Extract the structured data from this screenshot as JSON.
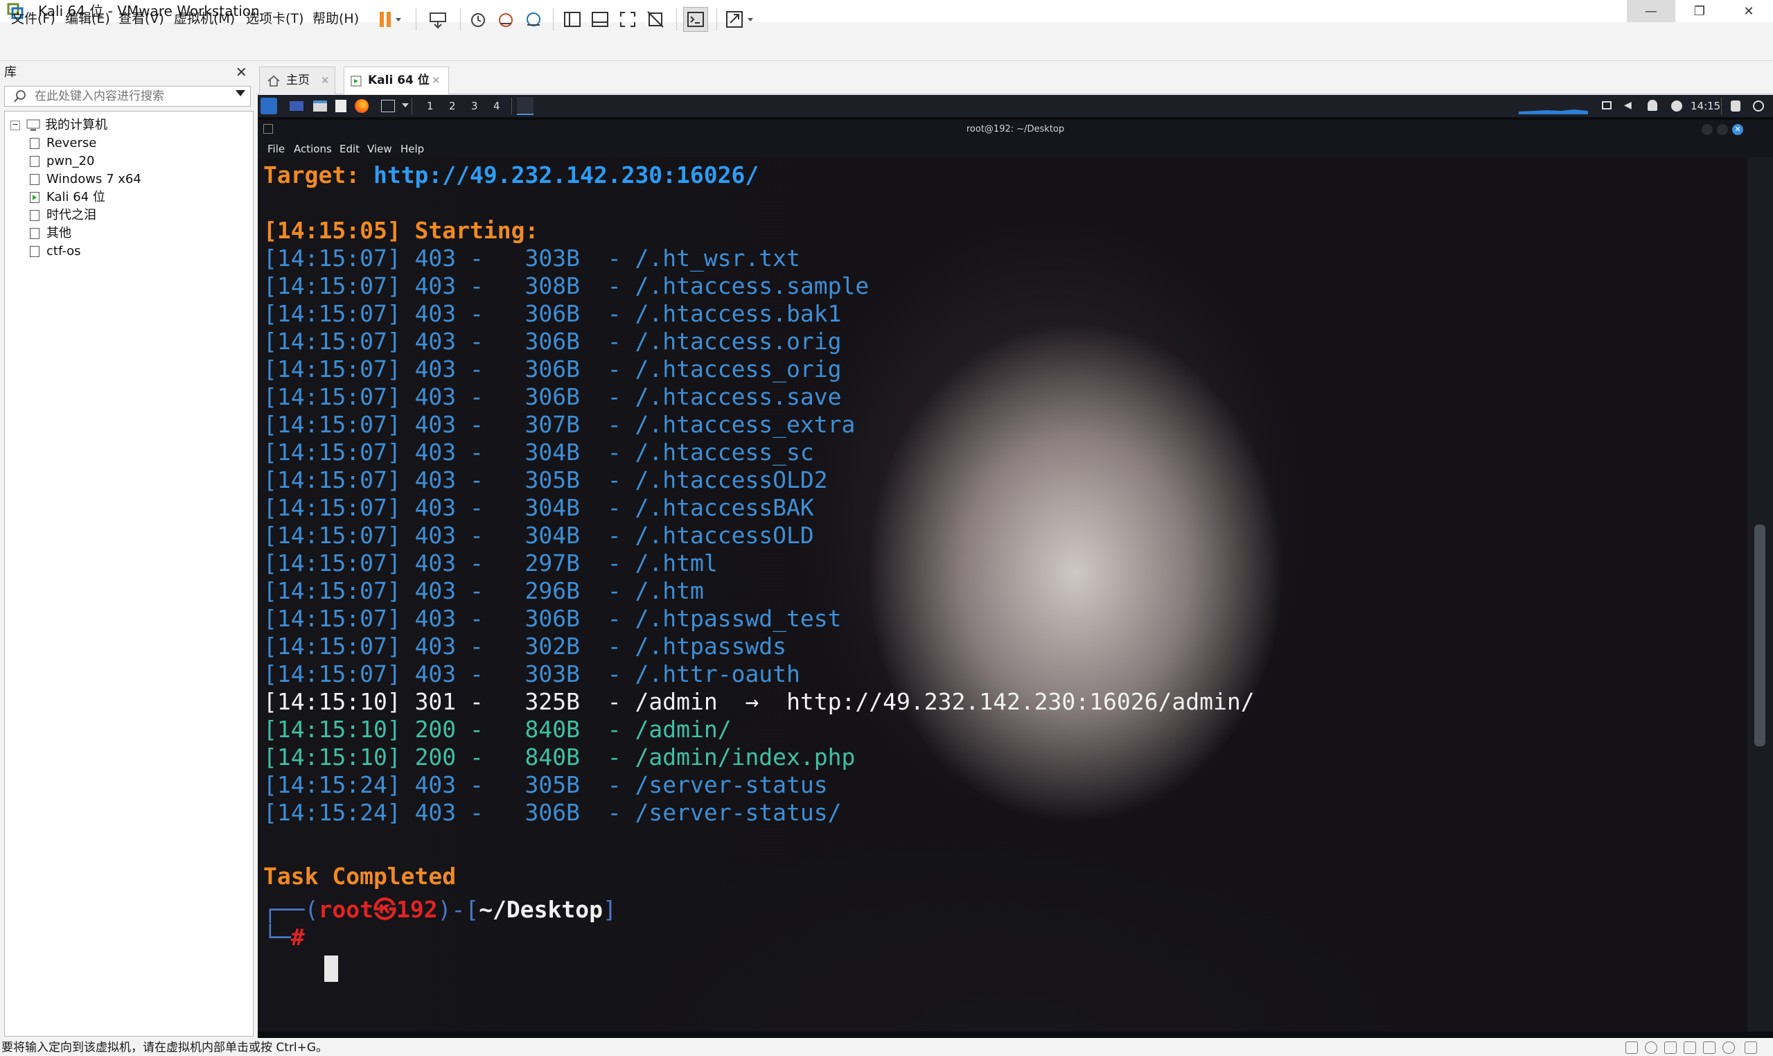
{
  "window": {
    "title": "Kali 64 位 - VMware Workstation",
    "controls": {
      "minimize": "—",
      "restore": "❐",
      "close": "✕"
    }
  },
  "menu": [
    "文件(F)",
    "编辑(E)",
    "查看(V)",
    "虚拟机(M)",
    "选项卡(T)",
    "帮助(H)"
  ],
  "library": {
    "title": "库",
    "close": "✕",
    "search_placeholder": "在此处键入内容进行搜索",
    "root": "我的计算机",
    "vms": [
      "Reverse",
      "pwn_20",
      "Windows 7 x64",
      "Kali 64 位",
      "时代之泪",
      "其他",
      "ctf-os"
    ],
    "running_vm_index": 3
  },
  "tabs": [
    {
      "label": "主页",
      "close": "✕"
    },
    {
      "label": "Kali 64 位",
      "close": "✕"
    }
  ],
  "kali_panel": {
    "workspaces": [
      "1",
      "2",
      "3",
      "4"
    ],
    "time": "14:15"
  },
  "terminal": {
    "title": "root@192: ~/Desktop",
    "menu": [
      "File",
      "Actions",
      "Edit",
      "View",
      "Help"
    ],
    "target_label": "Target:",
    "target_url": "http://49.232.142.230:16026/",
    "starting": "[14:15:05] Starting:",
    "results": [
      {
        "time": "[14:15:07]",
        "code": "403",
        "size": "303B",
        "path": "/.ht_wsr.txt",
        "redirect": ""
      },
      {
        "time": "[14:15:07]",
        "code": "403",
        "size": "308B",
        "path": "/.htaccess.sample",
        "redirect": ""
      },
      {
        "time": "[14:15:07]",
        "code": "403",
        "size": "306B",
        "path": "/.htaccess.bak1",
        "redirect": ""
      },
      {
        "time": "[14:15:07]",
        "code": "403",
        "size": "306B",
        "path": "/.htaccess.orig",
        "redirect": ""
      },
      {
        "time": "[14:15:07]",
        "code": "403",
        "size": "306B",
        "path": "/.htaccess_orig",
        "redirect": ""
      },
      {
        "time": "[14:15:07]",
        "code": "403",
        "size": "306B",
        "path": "/.htaccess.save",
        "redirect": ""
      },
      {
        "time": "[14:15:07]",
        "code": "403",
        "size": "307B",
        "path": "/.htaccess_extra",
        "redirect": ""
      },
      {
        "time": "[14:15:07]",
        "code": "403",
        "size": "304B",
        "path": "/.htaccess_sc",
        "redirect": ""
      },
      {
        "time": "[14:15:07]",
        "code": "403",
        "size": "305B",
        "path": "/.htaccessOLD2",
        "redirect": ""
      },
      {
        "time": "[14:15:07]",
        "code": "403",
        "size": "304B",
        "path": "/.htaccessBAK",
        "redirect": ""
      },
      {
        "time": "[14:15:07]",
        "code": "403",
        "size": "304B",
        "path": "/.htaccessOLD",
        "redirect": ""
      },
      {
        "time": "[14:15:07]",
        "code": "403",
        "size": "297B",
        "path": "/.html",
        "redirect": ""
      },
      {
        "time": "[14:15:07]",
        "code": "403",
        "size": "296B",
        "path": "/.htm",
        "redirect": ""
      },
      {
        "time": "[14:15:07]",
        "code": "403",
        "size": "306B",
        "path": "/.htpasswd_test",
        "redirect": ""
      },
      {
        "time": "[14:15:07]",
        "code": "403",
        "size": "302B",
        "path": "/.htpasswds",
        "redirect": ""
      },
      {
        "time": "[14:15:07]",
        "code": "403",
        "size": "303B",
        "path": "/.httr-oauth",
        "redirect": ""
      },
      {
        "time": "[14:15:10]",
        "code": "301",
        "size": "325B",
        "path": "/admin",
        "redirect": "http://49.232.142.230:16026/admin/"
      },
      {
        "time": "[14:15:10]",
        "code": "200",
        "size": "840B",
        "path": "/admin/",
        "redirect": ""
      },
      {
        "time": "[14:15:10]",
        "code": "200",
        "size": "840B",
        "path": "/admin/index.php",
        "redirect": ""
      },
      {
        "time": "[14:15:24]",
        "code": "403",
        "size": "305B",
        "path": "/server-status",
        "redirect": ""
      },
      {
        "time": "[14:15:24]",
        "code": "403",
        "size": "306B",
        "path": "/server-status/",
        "redirect": ""
      }
    ],
    "completed": "Task Completed",
    "prompt": {
      "user": "root",
      "at": "㉿",
      "host": "192",
      "cwd": "~/Desktop",
      "symbol": "#"
    }
  },
  "statusbar": {
    "text": "要将输入定向到该虚拟机，请在虚拟机内部单击或按 Ctrl+G。"
  },
  "colors": {
    "orange": "#f08a24",
    "blue": "#3d8fd6",
    "green": "#3ec1a6",
    "red": "#e02424"
  }
}
